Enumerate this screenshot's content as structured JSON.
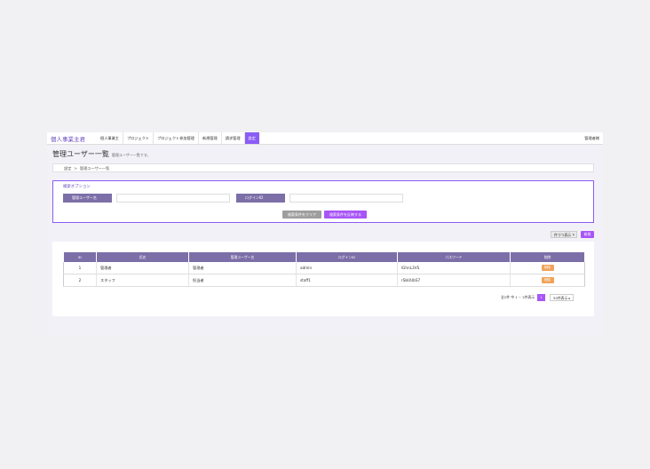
{
  "app": {
    "brand": "個人事業主君",
    "nav": [
      "個人事業主",
      "プロジェクト",
      "プロジェクト参加管理",
      "新規管理",
      "請求管理",
      "設定"
    ],
    "active_nav_index": 5,
    "logout": "管理者様"
  },
  "page": {
    "title": "管理ユーザー一覧",
    "subtitle": "管理ユーザー一覧です。"
  },
  "breadcrumb": {
    "items": [
      "設定",
      "管理ユーザー一覧"
    ],
    "separator": ">"
  },
  "search": {
    "title": "検索オプション",
    "fields": [
      {
        "label": "管理ユーザー名",
        "value": ""
      },
      {
        "label": "ログインID",
        "value": ""
      }
    ],
    "clear_label": "検索条件をクリア",
    "submit_label": "検索条件を反映する"
  },
  "toolbar": {
    "display_label": "件づつ表示",
    "new_label": "新規"
  },
  "table": {
    "headers": [
      "ID",
      "氏名",
      "管理ユーザー名",
      "ログインID",
      "パスワード",
      "削除"
    ],
    "rows": [
      {
        "id": "1",
        "name": "管理者",
        "admin_name": "管理者",
        "login_id": "admin",
        "password": "lGhnL3VS",
        "delete": "削除"
      },
      {
        "id": "2",
        "name": "スタッフ",
        "admin_name": "担当者",
        "login_id": "staff1",
        "password": "rSbUUbS7",
        "delete": "削除"
      }
    ]
  },
  "pagination": {
    "summary": "全2件 中 1 ~ 2件表示",
    "current_page": "1",
    "per_page_label": "50件表示"
  },
  "colors": {
    "accent": "#8b5cf6",
    "header_cell": "#7c6fa8",
    "delete_button": "#f0a35a",
    "clear_button": "#9e9e9e"
  }
}
